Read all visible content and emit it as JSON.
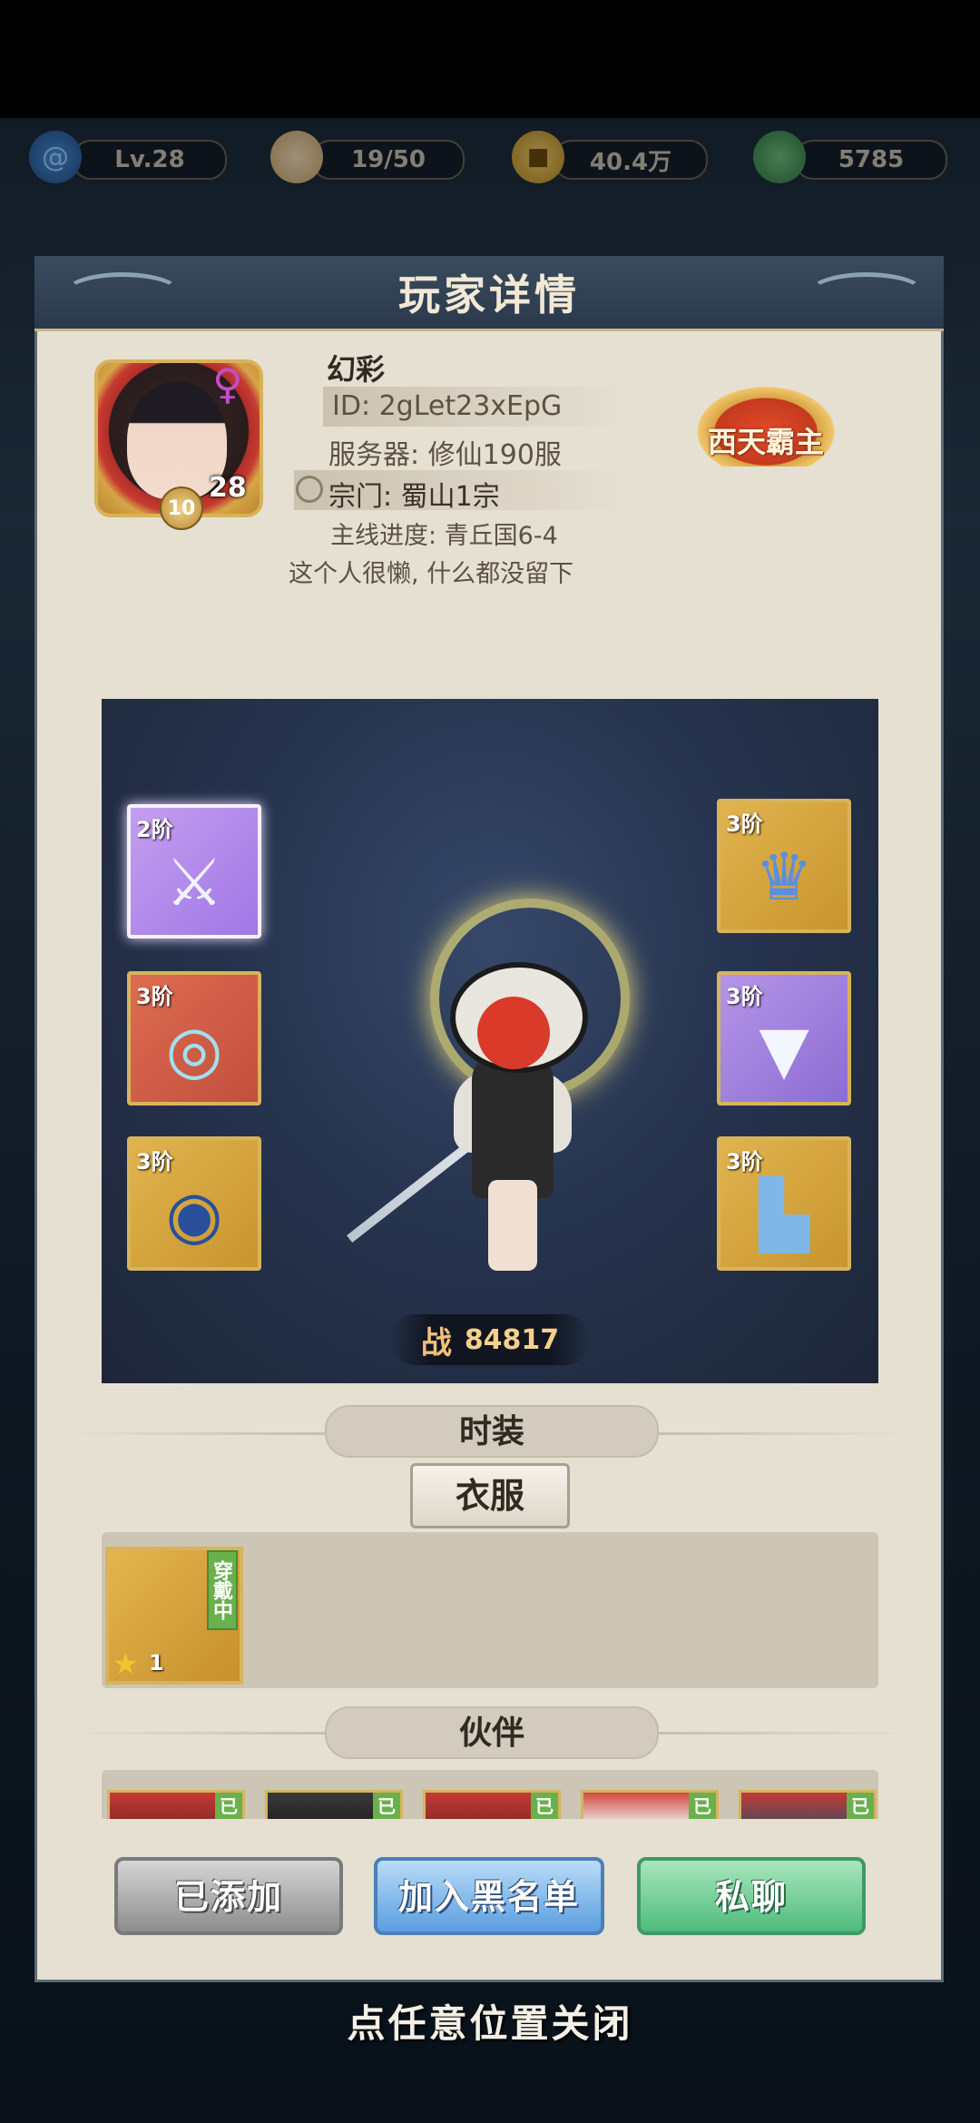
{
  "topbar": {
    "level": "Lv.28",
    "stamina": "19/50",
    "coins": "40.4万",
    "jade": "5785",
    "icons": [
      "swirl-icon",
      "bun-icon",
      "coin-icon",
      "leaf-icon"
    ]
  },
  "panel": {
    "title": "玩家详情"
  },
  "player": {
    "name": "幻彩",
    "id_line": "ID: 2gLet23xEpG",
    "server_line": "服务器: 修仙190服",
    "sect_line": "宗门: 蜀山1宗",
    "progress_line": "主线进度: 青丘国6-4",
    "signature": "这个人很懒, 什么都没留下",
    "avatar_level": "28",
    "avatar_badge": "10",
    "title_badge": "西天霸主",
    "gender_symbol": "♀"
  },
  "equipment": {
    "left": [
      {
        "tier": "2阶",
        "item": "sword-icon",
        "rarity": "pink"
      },
      {
        "tier": "3阶",
        "item": "jade-pendant-icon",
        "rarity": "red"
      },
      {
        "tier": "3阶",
        "item": "ring-icon",
        "rarity": "gold"
      }
    ],
    "right": [
      {
        "tier": "3阶",
        "item": "crown-icon",
        "rarity": "gold"
      },
      {
        "tier": "3阶",
        "item": "robe-icon",
        "rarity": "purple"
      },
      {
        "tier": "3阶",
        "item": "boots-icon",
        "rarity": "gold"
      }
    ]
  },
  "power": {
    "label": "战",
    "value": "84817"
  },
  "fashion": {
    "section_title": "时装",
    "tab_label": "衣服",
    "item": {
      "wearing_label": "穿戴中",
      "count": "1"
    }
  },
  "partners": {
    "section_title": "伙伴",
    "cards": [
      {
        "tag": "已"
      },
      {
        "tag": "已"
      },
      {
        "tag": "已"
      },
      {
        "tag": "已"
      },
      {
        "tag": "已"
      }
    ]
  },
  "actions": {
    "added_label": "已添加",
    "blacklist_label": "加入黑名单",
    "chat_label": "私聊"
  },
  "footer": {
    "close_hint": "点任意位置关闭"
  },
  "colors": {
    "panel_bg": "#e6e0d2",
    "header_bg": "#2a3a4c",
    "gold_slot": "#e1b34e",
    "blue_button": "#5b9ee0",
    "green_button": "#4fbb7c"
  }
}
